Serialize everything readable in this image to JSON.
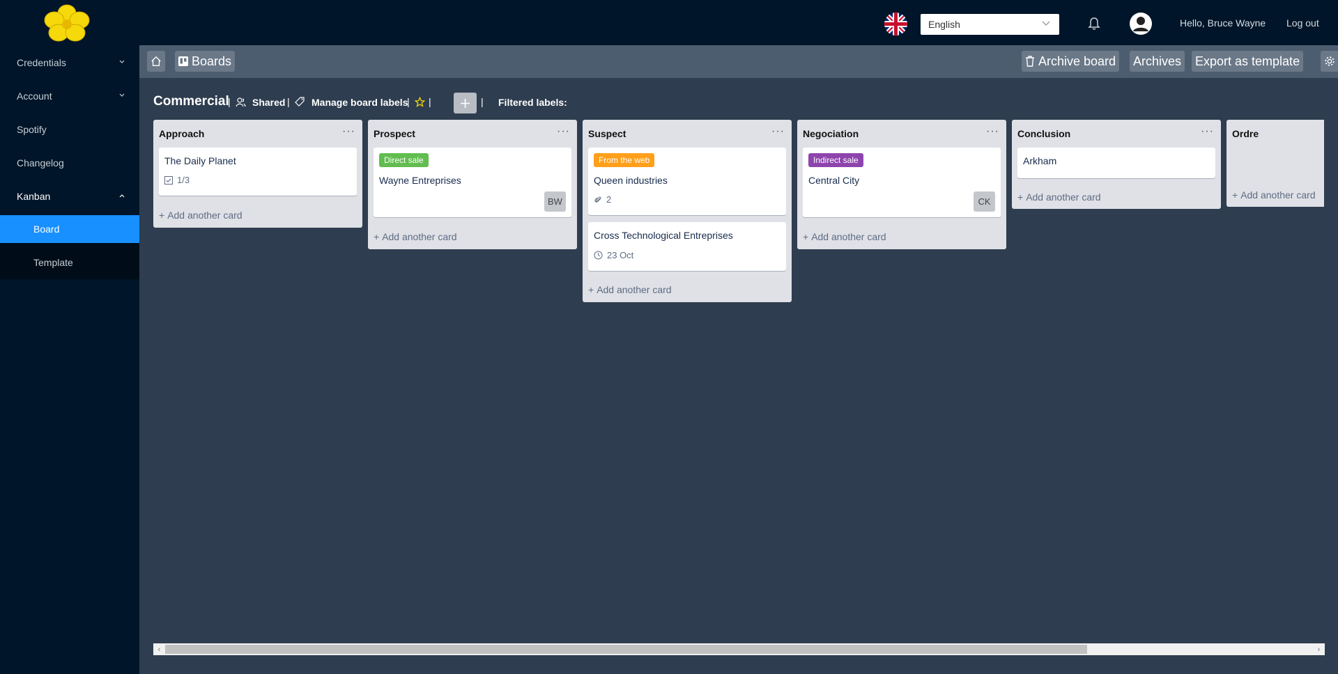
{
  "topbar": {
    "language": "English",
    "greeting": "Hello, Bruce Wayne",
    "logout": "Log out"
  },
  "sidebar": {
    "items": [
      {
        "label": "Credentials"
      },
      {
        "label": "Account"
      },
      {
        "label": "Spotify"
      },
      {
        "label": "Changelog"
      },
      {
        "label": "Kanban"
      }
    ],
    "kanban_sub": [
      {
        "label": "Board"
      },
      {
        "label": "Template"
      }
    ]
  },
  "toolbar": {
    "boards": "Boards",
    "archive_board": "Archive board",
    "archives": "Archives",
    "export_template": "Export as template"
  },
  "board": {
    "title": "Commercial",
    "shared": "Shared",
    "manage_labels": "Manage board labels",
    "filtered_labels": "Filtered labels:"
  },
  "lists": [
    {
      "title": "Approach",
      "add": "Add another card",
      "cards": [
        {
          "title": "The Daily Planet",
          "checklist": "1/3"
        }
      ]
    },
    {
      "title": "Prospect",
      "add": "Add another card",
      "cards": [
        {
          "label": "Direct sale",
          "label_color": "#61bd4f",
          "title": "Wayne Entreprises",
          "member": "BW"
        }
      ]
    },
    {
      "title": "Suspect",
      "add": "Add another card",
      "cards": [
        {
          "label": "From the web",
          "label_color": "#ff9f1a",
          "title": "Queen industries",
          "attachments": "2"
        },
        {
          "title": "Cross Technological Entreprises",
          "due": "23 Oct"
        }
      ]
    },
    {
      "title": "Negociation",
      "add": "Add another card",
      "cards": [
        {
          "label": "Indirect sale",
          "label_color": "#8e44ad",
          "title": "Central City",
          "member": "CK"
        }
      ]
    },
    {
      "title": "Conclusion",
      "add": "Add another card",
      "cards": [
        {
          "title": "Arkham"
        }
      ]
    },
    {
      "title": "Ordre",
      "add": "Add another card",
      "cards": []
    }
  ]
}
